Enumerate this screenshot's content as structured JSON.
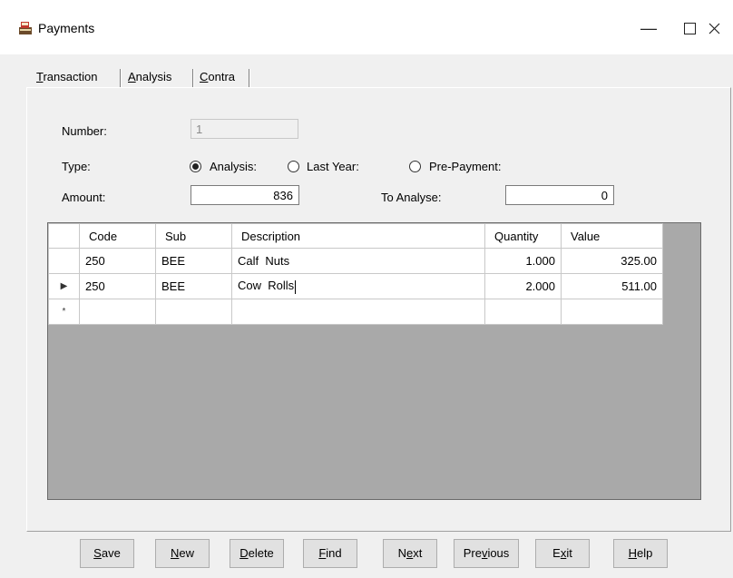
{
  "window": {
    "title": "Payments",
    "icons": {
      "app": "cash-register-icon",
      "minimize": "minimize-icon",
      "maximize": "maximize-icon",
      "close": "close-icon"
    }
  },
  "tabs": [
    {
      "pre": "",
      "key": "T",
      "post": "ransaction"
    },
    {
      "pre": "",
      "key": "A",
      "post": "nalysis"
    },
    {
      "pre": "",
      "key": "C",
      "post": "ontra"
    }
  ],
  "active_tab": "Analysis",
  "form": {
    "number_label": "Number:",
    "number_value": "1",
    "type_label": "Type:",
    "type_options": [
      "Analysis:",
      "Last Year:",
      "Pre-Payment:"
    ],
    "type_selected": "Analysis:",
    "amount_label": "Amount:",
    "amount_value": "836",
    "to_analyse_label": "To Analyse:",
    "to_analyse_value": "0"
  },
  "grid": {
    "columns": [
      "Code",
      "Sub",
      "Description",
      "Quantity",
      "Value"
    ],
    "rows": [
      {
        "marker": "",
        "code": "250",
        "sub": "BEE",
        "description": "Calf  Nuts",
        "quantity": "1.000",
        "value": "325.00"
      },
      {
        "marker": "▶",
        "code": "250",
        "sub": "BEE",
        "description": "Cow  Rolls",
        "quantity": "2.000",
        "value": "511.00"
      },
      {
        "marker": "*",
        "code": "",
        "sub": "",
        "description": "",
        "quantity": "",
        "value": ""
      }
    ]
  },
  "buttons": [
    {
      "pre": "",
      "key": "S",
      "post": "ave"
    },
    {
      "pre": "",
      "key": "N",
      "post": "ew"
    },
    {
      "pre": "",
      "key": "D",
      "post": "elete"
    },
    {
      "pre": "",
      "key": "F",
      "post": "ind"
    },
    {
      "pre": "N",
      "key": "e",
      "post": "xt"
    },
    {
      "pre": "Pre",
      "key": "v",
      "post": "ious"
    },
    {
      "pre": "E",
      "key": "x",
      "post": "it"
    },
    {
      "pre": "",
      "key": "H",
      "post": "elp"
    }
  ]
}
